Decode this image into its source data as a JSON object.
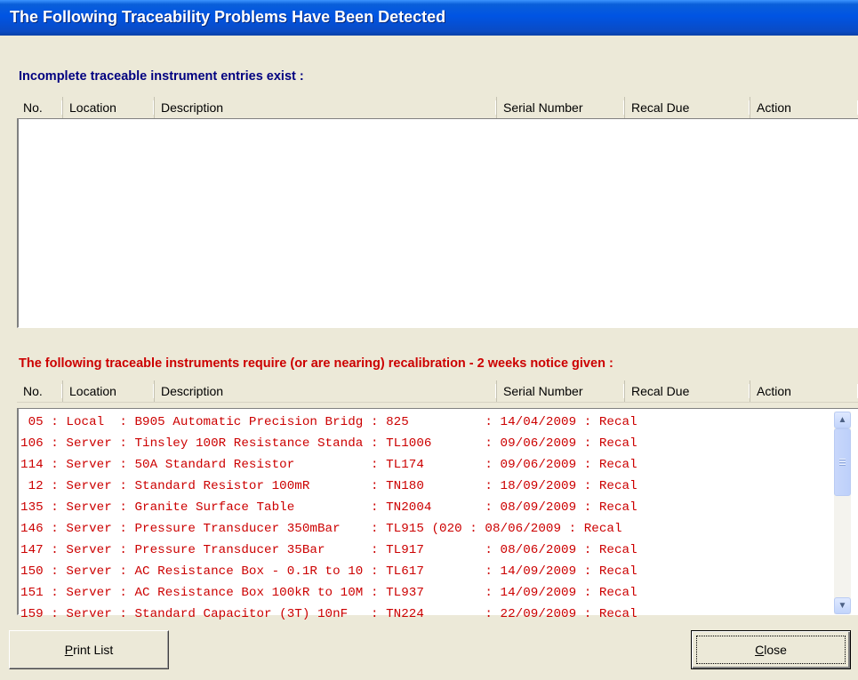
{
  "window": {
    "title": "The Following Traceability Problems Have Been Detected"
  },
  "incomplete": {
    "label": "Incomplete traceable instrument entries exist :",
    "columns": [
      "No.",
      "Location",
      "Description",
      "Serial Number",
      "Recal Due",
      "Action"
    ]
  },
  "recal": {
    "label": "The following traceable instruments require (or are nearing) recalibration - 2 weeks notice given :",
    "columns": [
      "No.",
      "Location",
      "Description",
      "Serial Number",
      "Recal Due",
      "Action"
    ],
    "rows": [
      " 05 : Local  : B905 Automatic Precision Bridg : 825          : 14/04/2009 : Recal",
      "106 : Server : Tinsley 100R Resistance Standa : TL1006       : 09/06/2009 : Recal",
      "114 : Server : 50A Standard Resistor          : TL174        : 09/06/2009 : Recal",
      " 12 : Server : Standard Resistor 100mR        : TN180        : 18/09/2009 : Recal",
      "135 : Server : Granite Surface Table          : TN2004       : 08/09/2009 : Recal",
      "146 : Server : Pressure Transducer 350mBar    : TL915 (020 : 08/06/2009 : Recal",
      "147 : Server : Pressure Transducer 35Bar      : TL917        : 08/06/2009 : Recal",
      "150 : Server : AC Resistance Box - 0.1R to 10 : TL617        : 14/09/2009 : Recal",
      "151 : Server : AC Resistance Box 100kR to 10M : TL937        : 14/09/2009 : Recal",
      "159 : Server : Standard Capacitor (3T) 10nF   : TN224        : 22/09/2009 : Recal"
    ]
  },
  "buttons": {
    "print": {
      "mnemonic": "P",
      "rest": "rint List"
    },
    "close": {
      "mnemonic": "C",
      "rest": "lose"
    }
  },
  "icons": {
    "scroll_up": "chevron-up-icon",
    "scroll_down": "chevron-down-icon"
  }
}
